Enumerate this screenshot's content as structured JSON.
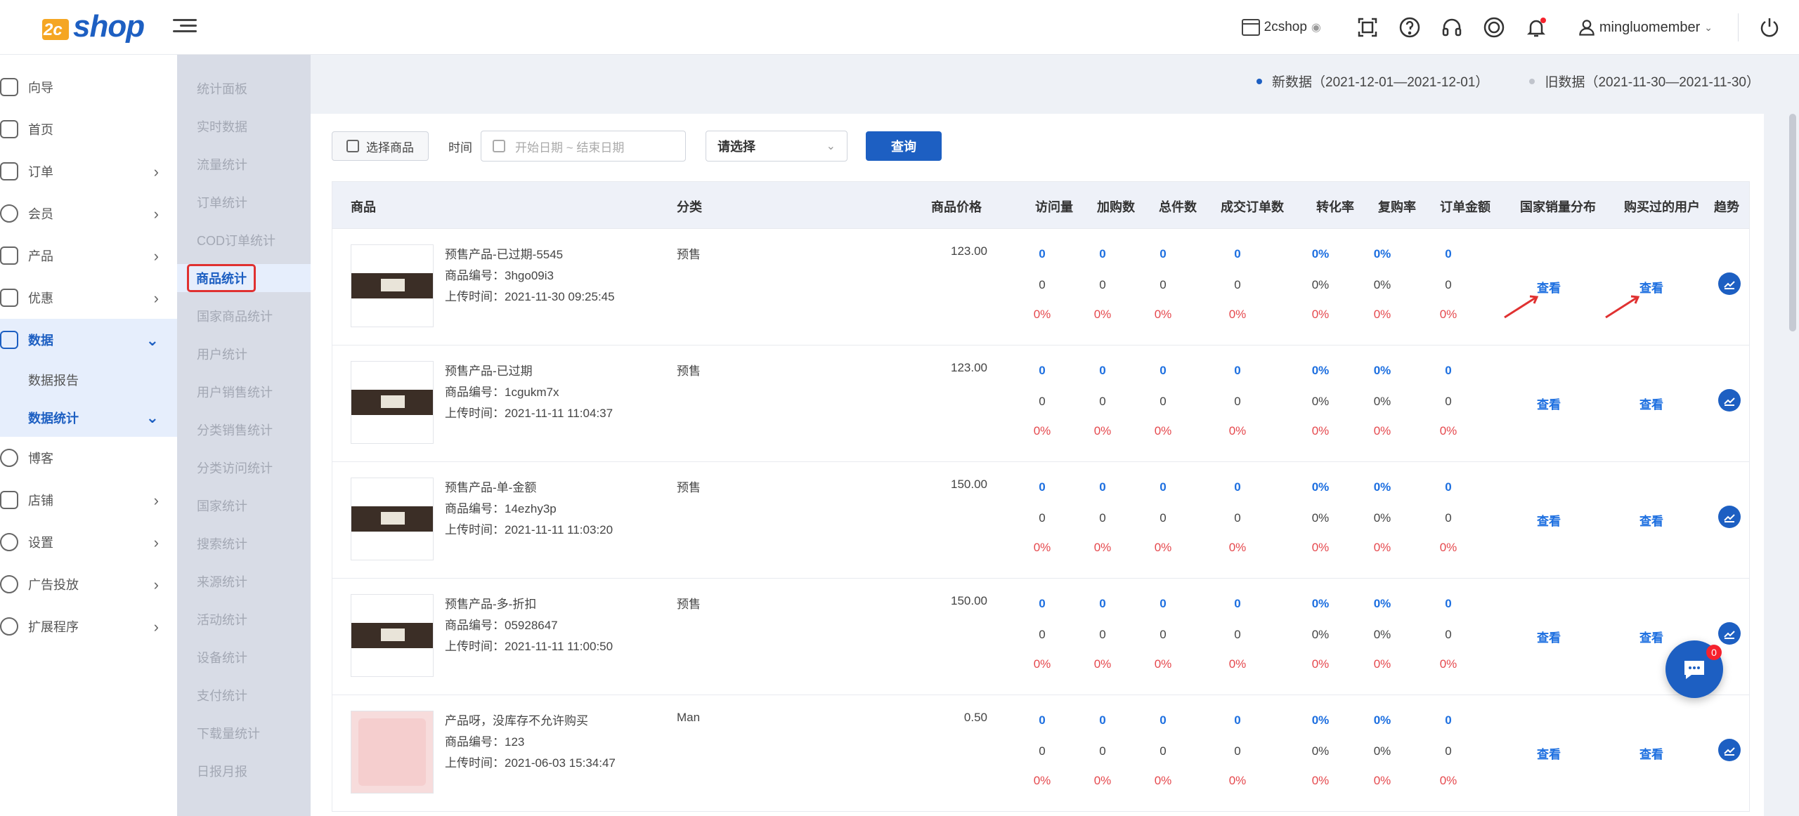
{
  "header": {
    "logo_prefix": "2c",
    "logo_text": "shop",
    "shop_name": "2cshop",
    "username": "mingluomember"
  },
  "sidebar": {
    "items": [
      {
        "label": "向导",
        "icon": "guide-icon"
      },
      {
        "label": "首页",
        "icon": "home-icon"
      },
      {
        "label": "订单",
        "icon": "order-icon",
        "arrow": true
      },
      {
        "label": "会员",
        "icon": "member-icon",
        "arrow": true
      },
      {
        "label": "产品",
        "icon": "product-icon",
        "arrow": true
      },
      {
        "label": "优惠",
        "icon": "discount-icon",
        "arrow": true
      },
      {
        "label": "数据",
        "icon": "data-icon",
        "expanded": true
      }
    ],
    "sub": [
      {
        "label": "数据报告"
      },
      {
        "label": "数据统计"
      }
    ],
    "items_after": [
      {
        "label": "博客",
        "icon": "blog-icon"
      },
      {
        "label": "店铺",
        "icon": "store-icon",
        "arrow": true
      },
      {
        "label": "设置",
        "icon": "settings-icon",
        "arrow": true
      },
      {
        "label": "广告投放",
        "icon": "ads-icon",
        "arrow": true
      },
      {
        "label": "扩展程序",
        "icon": "extension-icon",
        "arrow": true
      }
    ]
  },
  "subcol": {
    "items": [
      "统计面板",
      "实时数据",
      "流量统计",
      "订单统计",
      "COD订单统计",
      "商品统计",
      "国家商品统计",
      "用户统计",
      "用户销售统计",
      "分类销售统计",
      "分类访问统计",
      "国家统计",
      "搜索统计",
      "来源统计",
      "活动统计",
      "设备统计",
      "支付统计",
      "下载量统计",
      "日报月报"
    ],
    "active_index": 5
  },
  "legend": {
    "new": "新数据（2021-12-01—2021-12-01）",
    "old": "旧数据（2021-11-30—2021-11-30）",
    "new_color": "#1d5fc2",
    "old_color": "#c0c4cc"
  },
  "filters": {
    "select_product": "选择商品",
    "time_label": "时间",
    "date_placeholder": "开始日期 ~ 结束日期",
    "select_placeholder": "请选择",
    "query_button": "查询"
  },
  "table": {
    "headers": [
      "商品",
      "分类",
      "商品价格",
      "访问量",
      "加购数",
      "总件数",
      "成交订单数",
      "转化率",
      "复购率",
      "订单金额",
      "国家销量分布",
      "购买过的用户",
      "趋势"
    ],
    "view_label": "查看",
    "sku_prefix": "商品编号：",
    "time_prefix": "上传时间：",
    "rows": [
      {
        "name": "预售产品-已过期-5545",
        "sku": "3hgo09i3",
        "time": "2021-11-30 09:25:45",
        "category": "预售",
        "price": "123.00",
        "thumb": "dark",
        "new": [
          "0",
          "0",
          "0",
          "0",
          "0%",
          "0%",
          "0"
        ],
        "old": [
          "0",
          "0",
          "0",
          "0",
          "0%",
          "0%",
          "0"
        ],
        "change": [
          "0%",
          "0%",
          "0%",
          "0%",
          "0%",
          "0%",
          "0%"
        ]
      },
      {
        "name": "预售产品-已过期",
        "sku": "1cgukm7x",
        "time": "2021-11-11 11:04:37",
        "category": "预售",
        "price": "123.00",
        "thumb": "dark",
        "new": [
          "0",
          "0",
          "0",
          "0",
          "0%",
          "0%",
          "0"
        ],
        "old": [
          "0",
          "0",
          "0",
          "0",
          "0%",
          "0%",
          "0"
        ],
        "change": [
          "0%",
          "0%",
          "0%",
          "0%",
          "0%",
          "0%",
          "0%"
        ]
      },
      {
        "name": "预售产品-单-金额",
        "sku": "14ezhy3p",
        "time": "2021-11-11 11:03:20",
        "category": "预售",
        "price": "150.00",
        "thumb": "dark",
        "new": [
          "0",
          "0",
          "0",
          "0",
          "0%",
          "0%",
          "0"
        ],
        "old": [
          "0",
          "0",
          "0",
          "0",
          "0%",
          "0%",
          "0"
        ],
        "change": [
          "0%",
          "0%",
          "0%",
          "0%",
          "0%",
          "0%",
          "0%"
        ]
      },
      {
        "name": "预售产品-多-折扣",
        "sku": "05928647",
        "time": "2021-11-11 11:00:50",
        "category": "预售",
        "price": "150.00",
        "thumb": "dark",
        "new": [
          "0",
          "0",
          "0",
          "0",
          "0%",
          "0%",
          "0"
        ],
        "old": [
          "0",
          "0",
          "0",
          "0",
          "0%",
          "0%",
          "0"
        ],
        "change": [
          "0%",
          "0%",
          "0%",
          "0%",
          "0%",
          "0%",
          "0%"
        ]
      },
      {
        "name": "产品呀，没库存不允许购买",
        "sku": "123",
        "time": "2021-06-03 15:34:47",
        "category": "Man",
        "price": "0.50",
        "thumb": "pink",
        "new": [
          "0",
          "0",
          "0",
          "0",
          "0%",
          "0%",
          "0"
        ],
        "old": [
          "0",
          "0",
          "0",
          "0",
          "0%",
          "0%",
          "0"
        ],
        "change": [
          "0%",
          "0%",
          "0%",
          "0%",
          "0%",
          "0%",
          "0%"
        ]
      }
    ]
  },
  "chat": {
    "badge": "0"
  },
  "colors": {
    "accent": "#1d5fc2",
    "link": "#1d6fe0",
    "negative": "#e5484d",
    "highlight_box": "#e03131"
  }
}
